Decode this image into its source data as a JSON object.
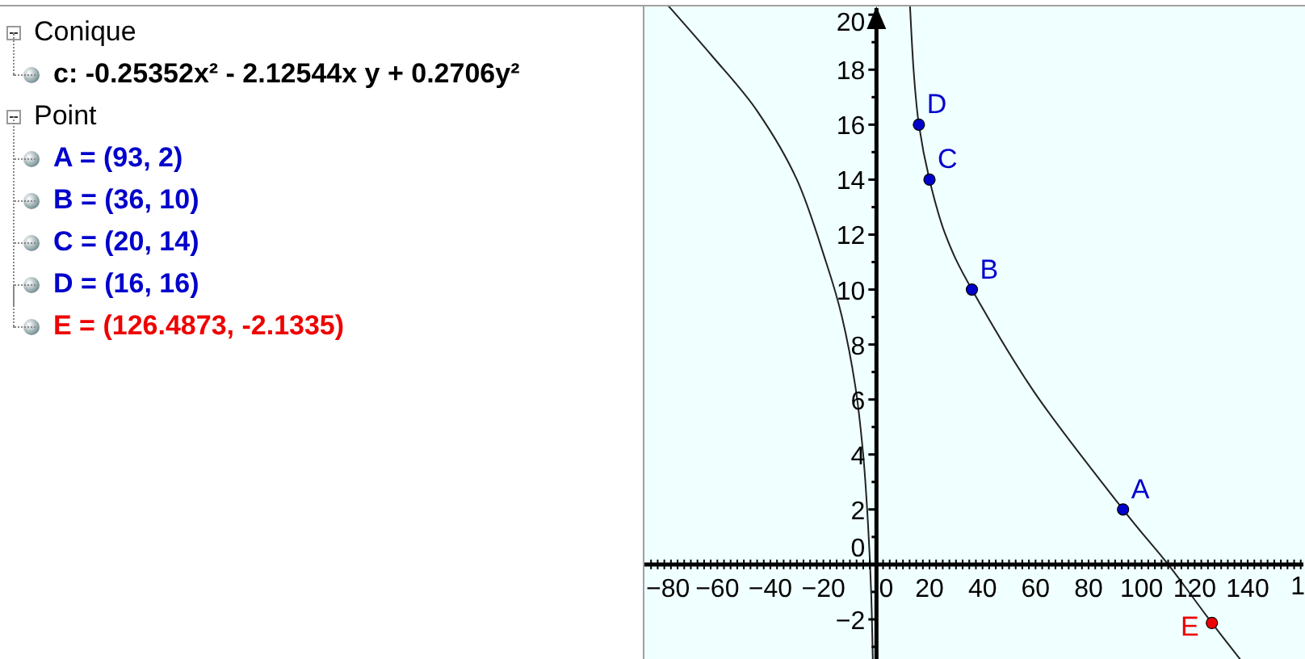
{
  "algebra": {
    "groups": [
      {
        "label": "Conique",
        "expanded": true,
        "items": [
          {
            "text": "c: -0.25352x² - 2.12544x y + 0.2706y²",
            "color": "#000000"
          }
        ]
      },
      {
        "label": "Point",
        "expanded": true,
        "items": [
          {
            "text": "A = (93, 2)",
            "color": "#0000cc"
          },
          {
            "text": "B = (36, 10)",
            "color": "#0000cc"
          },
          {
            "text": "C = (20, 14)",
            "color": "#0000cc"
          },
          {
            "text": "D = (16, 16)",
            "color": "#0000cc"
          },
          {
            "text": "E = (126.4873, -2.1335)",
            "color": "#ee0000"
          }
        ]
      }
    ]
  },
  "graphics": {
    "chart_data": {
      "type": "scatter",
      "xlim": [
        -87.5,
        161
      ],
      "ylim": [
        -3.5,
        20.3
      ],
      "xticks": [
        {
          "value": -80,
          "label": "−80"
        },
        {
          "value": -60,
          "label": "−60"
        },
        {
          "value": -40,
          "label": "−40"
        },
        {
          "value": -20,
          "label": "−20"
        },
        {
          "value": 0,
          "label": "0"
        },
        {
          "value": 20,
          "label": "20"
        },
        {
          "value": 40,
          "label": "40"
        },
        {
          "value": 60,
          "label": "60"
        },
        {
          "value": 80,
          "label": "80"
        },
        {
          "value": 100,
          "label": "100"
        },
        {
          "value": 120,
          "label": "120"
        },
        {
          "value": 140,
          "label": "140"
        }
      ],
      "yticks": [
        {
          "value": -2,
          "label": "−2"
        },
        {
          "value": 0,
          "label": "0"
        },
        {
          "value": 2,
          "label": "2"
        },
        {
          "value": 4,
          "label": "4"
        },
        {
          "value": 6,
          "label": "6"
        },
        {
          "value": 8,
          "label": "8"
        },
        {
          "value": 10,
          "label": "10"
        },
        {
          "value": 12,
          "label": "12"
        },
        {
          "value": 14,
          "label": "14"
        },
        {
          "value": 16,
          "label": "16"
        },
        {
          "value": 18,
          "label": "18"
        },
        {
          "value": 20,
          "label": "20"
        }
      ],
      "series": [
        {
          "color": "#0000cc",
          "x": [
            93,
            36,
            20,
            16
          ],
          "values": [
            2,
            10,
            14,
            16
          ]
        },
        {
          "color": "#ee0000",
          "x": [
            126.5
          ],
          "values": [
            -2.13
          ]
        }
      ],
      "annotations": [
        {
          "x": 93,
          "y": 2,
          "text": "A"
        },
        {
          "x": 36,
          "y": 10,
          "text": "B"
        },
        {
          "x": 20,
          "y": 14,
          "text": "C"
        },
        {
          "x": 16,
          "y": 16,
          "text": "D"
        },
        {
          "x": 126.5,
          "y": -2.13,
          "text": "E"
        }
      ]
    },
    "cut_tick_label": "1"
  }
}
